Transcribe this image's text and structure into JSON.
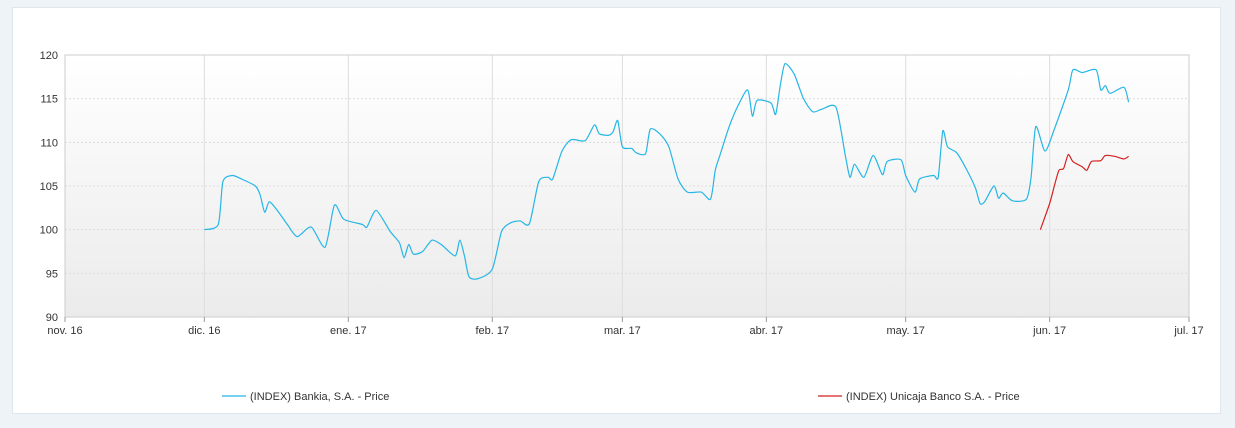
{
  "chart_data": {
    "type": "line",
    "x_ticks": [
      "nov. 16",
      "dic. 16",
      "ene. 17",
      "feb. 17",
      "mar. 17",
      "abr. 17",
      "may. 17",
      "jun. 17",
      "jul. 17"
    ],
    "x_tick_dates": [
      "2016-11-01",
      "2016-12-01",
      "2017-01-01",
      "2017-02-01",
      "2017-03-01",
      "2017-04-01",
      "2017-05-01",
      "2017-06-01",
      "2017-07-01"
    ],
    "y_ticks": [
      "90",
      "95",
      "100",
      "105",
      "110",
      "115",
      "120"
    ],
    "xlim": [
      "2016-11-01",
      "2017-07-01"
    ],
    "ylim": [
      90,
      120
    ],
    "grid": true,
    "legend_position": "bottom",
    "series": [
      {
        "name": "(INDEX) Bankia, S.A. - Price",
        "color": "#25b6e6",
        "points": [
          [
            "2016-12-01",
            100.0
          ],
          [
            "2016-12-04",
            100.6
          ],
          [
            "2016-12-05",
            105.5
          ],
          [
            "2016-12-07",
            106.2
          ],
          [
            "2016-12-09",
            105.8
          ],
          [
            "2016-12-12",
            105.0
          ],
          [
            "2016-12-13",
            104.0
          ],
          [
            "2016-12-14",
            102.0
          ],
          [
            "2016-12-15",
            103.2
          ],
          [
            "2016-12-17",
            102.0
          ],
          [
            "2016-12-19",
            100.5
          ],
          [
            "2016-12-21",
            99.2
          ],
          [
            "2016-12-24",
            100.3
          ],
          [
            "2016-12-27",
            98.0
          ],
          [
            "2016-12-29",
            102.8
          ],
          [
            "2016-12-31",
            101.2
          ],
          [
            "2017-01-04",
            100.6
          ],
          [
            "2017-01-05",
            100.3
          ],
          [
            "2017-01-07",
            102.2
          ],
          [
            "2017-01-10",
            99.8
          ],
          [
            "2017-01-12",
            98.5
          ],
          [
            "2017-01-13",
            96.8
          ],
          [
            "2017-01-14",
            98.3
          ],
          [
            "2017-01-15",
            97.2
          ],
          [
            "2017-01-17",
            97.5
          ],
          [
            "2017-01-19",
            98.8
          ],
          [
            "2017-01-21",
            98.3
          ],
          [
            "2017-01-24",
            97.0
          ],
          [
            "2017-01-25",
            98.8
          ],
          [
            "2017-01-26",
            97.0
          ],
          [
            "2017-01-27",
            94.6
          ],
          [
            "2017-01-29",
            94.4
          ],
          [
            "2017-02-01",
            95.5
          ],
          [
            "2017-02-03",
            99.8
          ],
          [
            "2017-02-05",
            100.8
          ],
          [
            "2017-02-07",
            101.0
          ],
          [
            "2017-02-09",
            100.7
          ],
          [
            "2017-02-11",
            105.5
          ],
          [
            "2017-02-13",
            106.0
          ],
          [
            "2017-02-14",
            105.8
          ],
          [
            "2017-02-16",
            109.0
          ],
          [
            "2017-02-18",
            110.3
          ],
          [
            "2017-02-21",
            110.2
          ],
          [
            "2017-02-23",
            112.0
          ],
          [
            "2017-02-24",
            111.0
          ],
          [
            "2017-02-26",
            110.8
          ],
          [
            "2017-02-27",
            111.2
          ],
          [
            "2017-02-28",
            112.5
          ],
          [
            "2017-03-01",
            109.5
          ],
          [
            "2017-03-03",
            109.3
          ],
          [
            "2017-03-04",
            108.8
          ],
          [
            "2017-03-06",
            108.7
          ],
          [
            "2017-03-07",
            111.5
          ],
          [
            "2017-03-09",
            111.0
          ],
          [
            "2017-03-11",
            109.5
          ],
          [
            "2017-03-13",
            105.8
          ],
          [
            "2017-03-15",
            104.3
          ],
          [
            "2017-03-18",
            104.3
          ],
          [
            "2017-03-20",
            103.5
          ],
          [
            "2017-03-21",
            106.8
          ],
          [
            "2017-03-22",
            108.5
          ],
          [
            "2017-03-24",
            111.8
          ],
          [
            "2017-03-26",
            114.3
          ],
          [
            "2017-03-28",
            116.0
          ],
          [
            "2017-03-29",
            113.0
          ],
          [
            "2017-03-30",
            114.8
          ],
          [
            "2017-04-02",
            114.5
          ],
          [
            "2017-04-03",
            113.2
          ],
          [
            "2017-04-04",
            116.5
          ],
          [
            "2017-04-05",
            119.0
          ],
          [
            "2017-04-07",
            117.8
          ],
          [
            "2017-04-09",
            115.0
          ],
          [
            "2017-04-11",
            113.5
          ],
          [
            "2017-04-13",
            113.8
          ],
          [
            "2017-04-16",
            114.0
          ],
          [
            "2017-04-18",
            108.5
          ],
          [
            "2017-04-19",
            106.0
          ],
          [
            "2017-04-20",
            107.5
          ],
          [
            "2017-04-22",
            106.0
          ],
          [
            "2017-04-24",
            108.5
          ],
          [
            "2017-04-26",
            106.3
          ],
          [
            "2017-04-27",
            107.8
          ],
          [
            "2017-04-30",
            108.0
          ],
          [
            "2017-05-01",
            106.2
          ],
          [
            "2017-05-03",
            104.3
          ],
          [
            "2017-05-04",
            105.8
          ],
          [
            "2017-05-07",
            106.2
          ],
          [
            "2017-05-08",
            106.0
          ],
          [
            "2017-05-09",
            111.3
          ],
          [
            "2017-05-10",
            109.5
          ],
          [
            "2017-05-12",
            108.8
          ],
          [
            "2017-05-14",
            107.0
          ],
          [
            "2017-05-16",
            104.8
          ],
          [
            "2017-05-17",
            103.0
          ],
          [
            "2017-05-18",
            103.2
          ],
          [
            "2017-05-20",
            105.0
          ],
          [
            "2017-05-21",
            103.6
          ],
          [
            "2017-05-22",
            104.2
          ],
          [
            "2017-05-24",
            103.3
          ],
          [
            "2017-05-27",
            103.5
          ],
          [
            "2017-05-28",
            106.0
          ],
          [
            "2017-05-29",
            111.8
          ],
          [
            "2017-05-31",
            109.0
          ],
          [
            "2017-06-02",
            111.5
          ],
          [
            "2017-06-05",
            116.0
          ],
          [
            "2017-06-06",
            118.3
          ],
          [
            "2017-06-08",
            118.0
          ],
          [
            "2017-06-11",
            118.3
          ],
          [
            "2017-06-12",
            116.0
          ],
          [
            "2017-06-13",
            116.5
          ],
          [
            "2017-06-14",
            115.6
          ],
          [
            "2017-06-17",
            116.3
          ],
          [
            "2017-06-18",
            114.6
          ]
        ]
      },
      {
        "name": "(INDEX) Unicaja Banco S.A. - Price",
        "color": "#d42020",
        "points": [
          [
            "2017-05-30",
            100.0
          ],
          [
            "2017-06-01",
            103.0
          ],
          [
            "2017-06-02",
            105.0
          ],
          [
            "2017-06-03",
            106.8
          ],
          [
            "2017-06-04",
            107.0
          ],
          [
            "2017-06-05",
            108.6
          ],
          [
            "2017-06-06",
            107.8
          ],
          [
            "2017-06-08",
            107.2
          ],
          [
            "2017-06-09",
            106.8
          ],
          [
            "2017-06-10",
            107.8
          ],
          [
            "2017-06-12",
            107.9
          ],
          [
            "2017-06-13",
            108.5
          ],
          [
            "2017-06-15",
            108.4
          ],
          [
            "2017-06-17",
            108.1
          ],
          [
            "2017-06-18",
            108.4
          ]
        ]
      }
    ]
  }
}
